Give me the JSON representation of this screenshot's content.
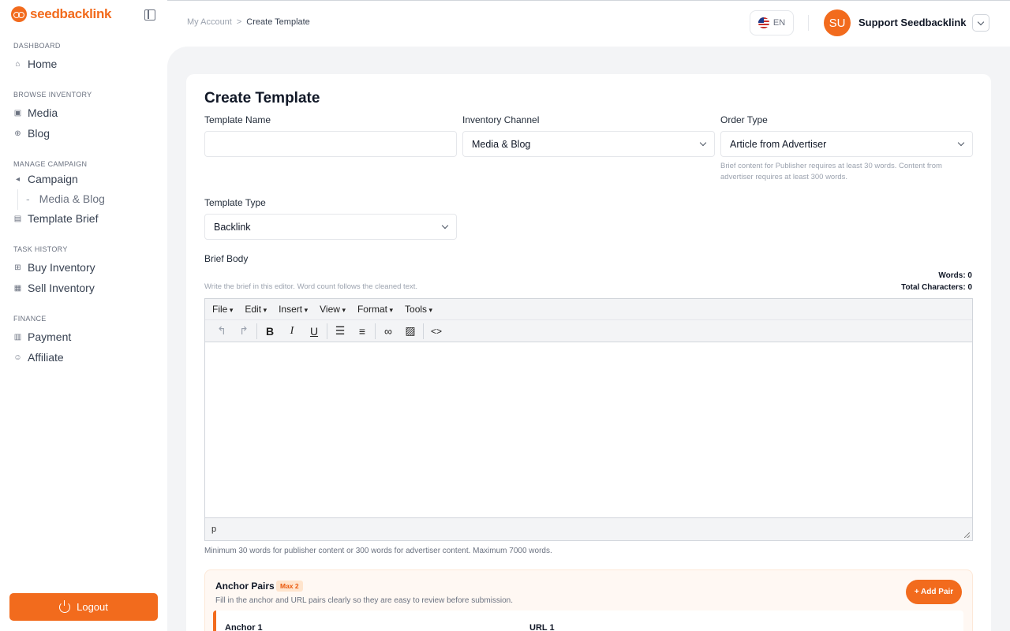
{
  "brand": {
    "name": "seedbacklink",
    "accent": "#f26b1d"
  },
  "sidebar": {
    "sections": [
      {
        "title": "DASHBOARD"
      },
      {
        "title": "BROWSE INVENTORY"
      },
      {
        "title": "MANAGE CAMPAIGN"
      },
      {
        "title": "TASK HISTORY"
      },
      {
        "title": "FINANCE"
      }
    ],
    "items": [
      {
        "label": "Home",
        "icon": "home-icon"
      },
      {
        "label": "Media",
        "icon": "monitor-icon"
      },
      {
        "label": "Blog",
        "icon": "globe-icon"
      },
      {
        "label": "Campaign",
        "icon": "megaphone-icon"
      },
      {
        "label": "Media & Blog",
        "prefix": "-"
      },
      {
        "label": "Template Brief",
        "icon": "document-icon"
      },
      {
        "label": "Buy Inventory",
        "icon": "cart-icon"
      },
      {
        "label": "Sell Inventory",
        "icon": "store-icon"
      },
      {
        "label": "Payment",
        "icon": "wallet-icon"
      },
      {
        "label": "Affiliate",
        "icon": "users-icon"
      }
    ],
    "logout_label": "Logout"
  },
  "header": {
    "breadcrumb": {
      "parent": "My Account",
      "separator": ">",
      "current": "Create Template"
    },
    "language": "EN",
    "avatar_initials": "SU",
    "user_name": "Support Seedbacklink"
  },
  "form": {
    "title": "Create Template",
    "template_name": {
      "label": "Template Name",
      "value": ""
    },
    "inventory_channel": {
      "label": "Inventory Channel",
      "value": "Media & Blog"
    },
    "order_type": {
      "label": "Order Type",
      "value": "Article from Advertiser",
      "hint": "Brief content for Publisher requires at least 30 words. Content from advertiser requires at least 300 words."
    },
    "template_type": {
      "label": "Template Type",
      "value": "Backlink"
    },
    "brief_body": {
      "label": "Brief Body",
      "hint": "Write the brief in this editor. Word count follows the cleaned text.",
      "words": "Words: 0",
      "characters": "Total Characters: 0",
      "footer_hint": "Minimum 30 words for publisher content or 300 words for advertiser content. Maximum 7000 words."
    }
  },
  "editor": {
    "menus": [
      "File",
      "Edit",
      "Insert",
      "View",
      "Format",
      "Tools"
    ],
    "status_path": "p"
  },
  "anchor_pairs": {
    "title": "Anchor Pairs",
    "badge": "Max 2",
    "description": "Fill in the anchor and URL pairs clearly so they are easy to review before submission.",
    "add_label": "+ Add Pair",
    "anchor_label": "Anchor 1",
    "url_label": "URL 1"
  }
}
